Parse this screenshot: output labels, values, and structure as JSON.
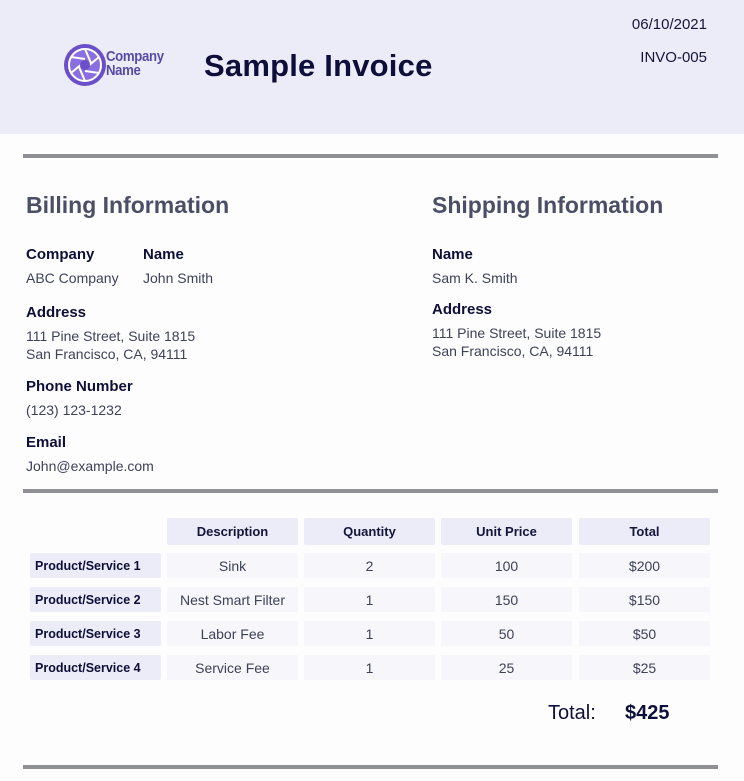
{
  "header": {
    "logo_text_line1": "Company",
    "logo_text_line2": "Name",
    "title": "Sample Invoice",
    "date": "06/10/2021",
    "invoice_number": "INVO-005"
  },
  "billing": {
    "heading": "Billing Information",
    "company_label": "Company",
    "company": "ABC Company",
    "name_label": "Name",
    "name": "John Smith",
    "address_label": "Address",
    "address_line1": "111 Pine Street, Suite 1815",
    "address_line2": "San Francisco, CA, 94111",
    "phone_label": "Phone Number",
    "phone": "(123) 123-1232",
    "email_label": "Email",
    "email": "John@example.com"
  },
  "shipping": {
    "heading": "Shipping Information",
    "name_label": "Name",
    "name": "Sam K. Smith",
    "address_label": "Address",
    "address_line1": "111 Pine Street, Suite 1815",
    "address_line2": "San Francisco, CA, 94111"
  },
  "items": {
    "headers": [
      "Description",
      "Quantity",
      "Unit Price",
      "Total"
    ],
    "rows": [
      {
        "label": "Product/Service 1",
        "description": "Sink",
        "quantity": "2",
        "unit_price": "100",
        "total": "$200"
      },
      {
        "label": "Product/Service 2",
        "description": "Nest Smart Filter",
        "quantity": "1",
        "unit_price": "150",
        "total": "$150"
      },
      {
        "label": "Product/Service 3",
        "description": "Labor Fee",
        "quantity": "1",
        "unit_price": "50",
        "total": "$50"
      },
      {
        "label": "Product/Service 4",
        "description": "Service Fee",
        "quantity": "1",
        "unit_price": "25",
        "total": "$25"
      }
    ]
  },
  "totals": {
    "label": "Total:",
    "value": "$425"
  },
  "colors": {
    "header_bg": "#ecebf8",
    "logo_purple": "#6b4fc8",
    "rule_gray": "#8f9093"
  }
}
